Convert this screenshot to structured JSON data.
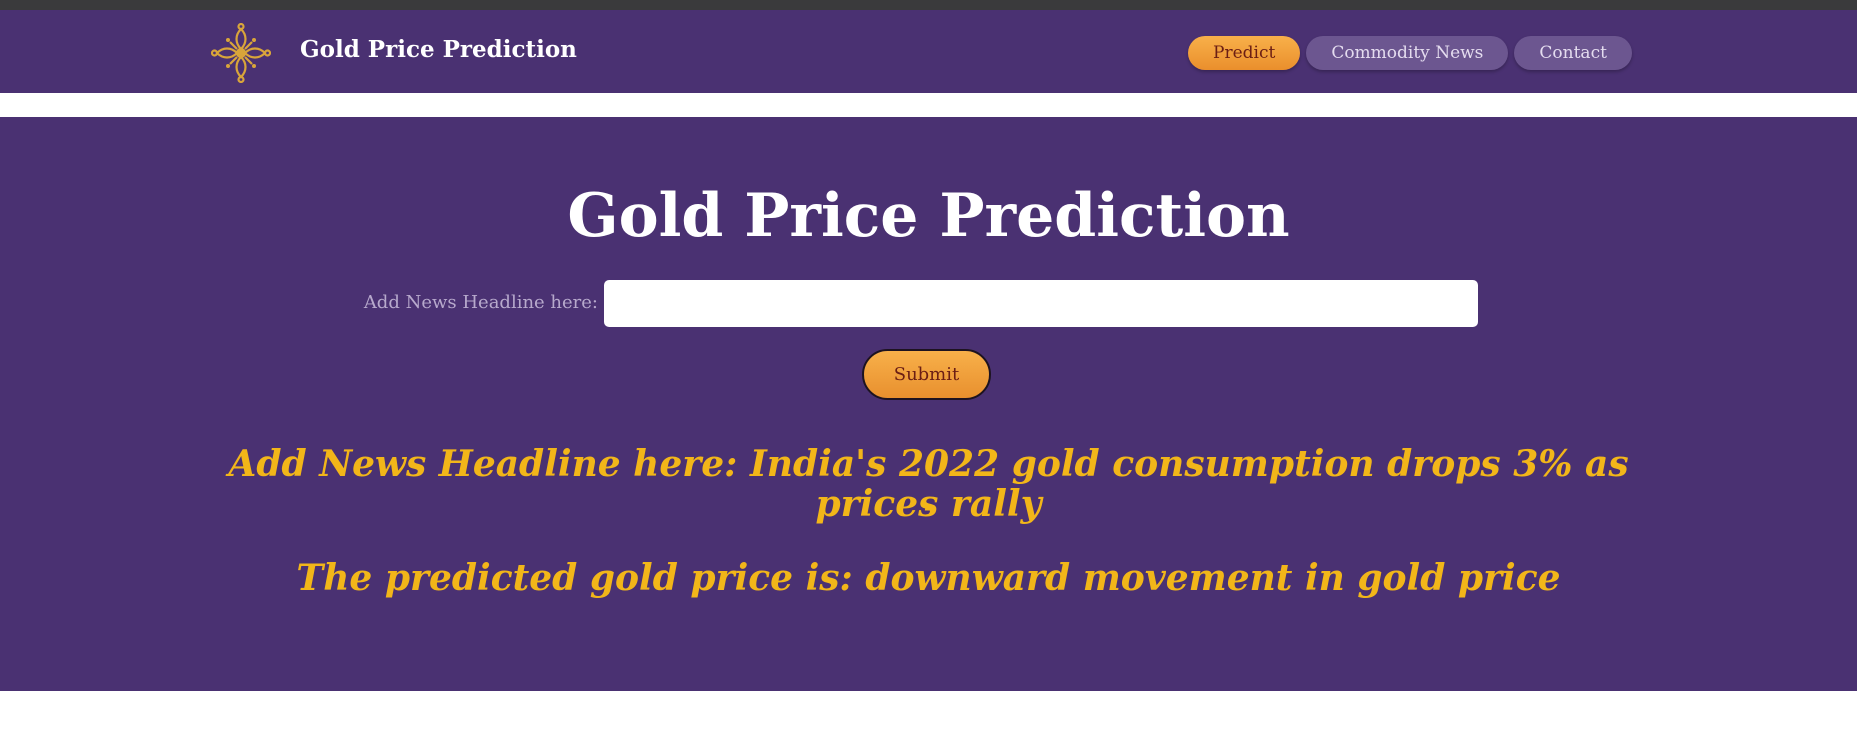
{
  "navbar": {
    "brand": "Gold Price Prediction",
    "logo_icon": "ornate-cross-logo-icon",
    "links": [
      {
        "label": "Predict",
        "active": true
      },
      {
        "label": "Commodity News",
        "active": false
      },
      {
        "label": "Contact",
        "active": false
      }
    ]
  },
  "hero": {
    "title": "Gold Price Prediction",
    "input_label": "Add News Headline here:",
    "input_value": "",
    "submit_label": "Submit"
  },
  "result": {
    "headline_text": "Add News Headline here: India's 2022 gold consumption drops 3% as prices rally",
    "separator": "-",
    "prediction_text": "The predicted gold price is: downward movement in gold price"
  },
  "colors": {
    "primary_purple": "#4a3172",
    "accent_orange": "#f5a33d",
    "result_gold": "#f2b619"
  }
}
